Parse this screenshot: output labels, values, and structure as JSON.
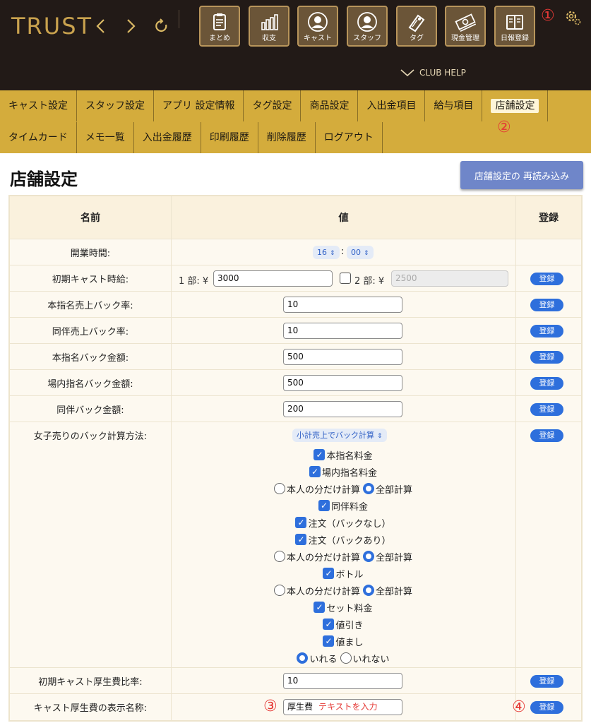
{
  "header": {
    "logo": "TRUST",
    "tools": [
      {
        "label": "まとめ",
        "icon": "clipboard-icon"
      },
      {
        "label": "収支",
        "icon": "bar-chart-icon"
      },
      {
        "label": "キャスト",
        "icon": "cast-person-icon"
      },
      {
        "label": "スタッフ",
        "icon": "staff-person-icon"
      },
      {
        "label": "タグ",
        "icon": "tag-icon"
      },
      {
        "label": "現金管理",
        "icon": "cash-icon"
      },
      {
        "label": "日報登録",
        "icon": "book-icon"
      }
    ],
    "help": "CLUB HELP",
    "markers": {
      "m1": "①",
      "m2": "②",
      "m3": "③",
      "m4": "④"
    }
  },
  "menu": {
    "row1": [
      "キャスト設定",
      "スタッフ設定",
      "アプリ 設定情報",
      "タグ設定",
      "商品設定",
      "入出金項目",
      "給与項目",
      "店舗設定"
    ],
    "row2": [
      "タイムカード",
      "メモ一覧",
      "入出金履歴",
      "印刷履歴",
      "削除履歴",
      "ログアウト"
    ],
    "active": "店舗設定"
  },
  "page": {
    "title": "店舗設定",
    "reload_label": "店舗設定の 再読み込み"
  },
  "table": {
    "headers": {
      "name": "名前",
      "value": "値",
      "register": "登録"
    },
    "register_label": "登録",
    "rows": {
      "open_time": {
        "label": "開業時間:",
        "hour": "16",
        "minute": "00",
        "sep": ":"
      },
      "initial_wage": {
        "label": "初期キャスト時給:",
        "part1_label": "1 部: ¥",
        "part1_value": "3000",
        "part2_label": "2 部: ¥",
        "part2_value": "2500"
      },
      "nomination_rate": {
        "label": "本指名売上バック率:",
        "value": "10"
      },
      "companion_rate": {
        "label": "同伴売上バック率:",
        "value": "10"
      },
      "nomination_amount": {
        "label": "本指名バック金額:",
        "value": "500"
      },
      "inhouse_amount": {
        "label": "場内指名バック金額:",
        "value": "500"
      },
      "companion_amount": {
        "label": "同伴バック金額:",
        "value": "200"
      },
      "girls_back": {
        "label": "女子売りのバック計算方法:",
        "select": "小計売上でバック計算",
        "options": {
          "nomination_fee": "本指名料金",
          "inhouse_fee": "場内指名料金",
          "own_only": "本人の分だけ計算",
          "all_calc": "全部計算",
          "companion_fee": "同伴料金",
          "order_no_back": "注文（バックなし）",
          "order_back": "注文（バックあり）",
          "bottle": "ボトル",
          "set_fee": "セット料金",
          "discount": "値引き",
          "surcharge": "値まし",
          "include": "いれる",
          "exclude": "いれない"
        }
      },
      "welfare_rate": {
        "label": "初期キャスト厚生費比率:",
        "value": "10"
      },
      "welfare_name": {
        "label": "キャスト厚生費の表示名称:",
        "value": "厚生費",
        "placeholder": "テキストを入力"
      }
    }
  },
  "colors": {
    "header_bg": "#221a17",
    "menu_bg": "#d4ac3c",
    "accent_blue": "#2e6fdc",
    "gold": "#c9a24e"
  }
}
